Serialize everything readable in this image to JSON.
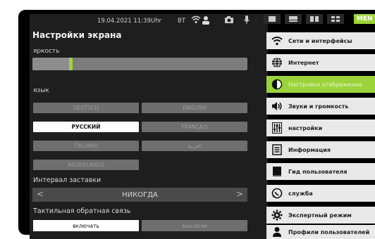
{
  "status": {
    "datetime": "19.04.2021 11:39Uhr",
    "bt": "BT"
  },
  "title": "Настройки экрана",
  "brightness": {
    "label": "яркость",
    "level": 0.17
  },
  "language": {
    "label": "язык",
    "options": [
      "DEUTSCH",
      "ENGLISH",
      "РУССКИЙ",
      "FRANÇAIS",
      "ITALIANO",
      "العربية",
      "NEDERLANDS"
    ],
    "selected": "РУССКИЙ"
  },
  "screensaver": {
    "label": "Интервал заставки",
    "value": "НИКОГДА",
    "prev": "<",
    "next": ">"
  },
  "haptic": {
    "label": "Тактильная обратная связь",
    "on": "включать",
    "off": "выключи"
  },
  "topbar": {
    "menu_label": "MEN"
  },
  "menu": [
    {
      "label": "Сети и интерфейсы",
      "icon": "wifi-icon"
    },
    {
      "label": "Интернет",
      "icon": "globe-icon"
    },
    {
      "label": "Настройки отображения",
      "icon": "contrast-icon",
      "active": true
    },
    {
      "label": "Звуки и громкость",
      "icon": "speaker-icon"
    },
    {
      "label": "настройки",
      "icon": "sliders-icon"
    },
    {
      "label": "Информация",
      "icon": "info-doc-icon"
    },
    {
      "label": "Гид пользователя",
      "icon": "book-icon"
    },
    {
      "label": "служба",
      "icon": "whatsapp-icon"
    },
    {
      "label": "Экспертный режим",
      "icon": "gear-icon"
    },
    {
      "label": "Профили пользователей",
      "icon": "user-icon"
    }
  ],
  "colors": {
    "accent": "#9bd43a",
    "panel": "#1e1e1e",
    "menu_bg": "#e9e9e9"
  }
}
